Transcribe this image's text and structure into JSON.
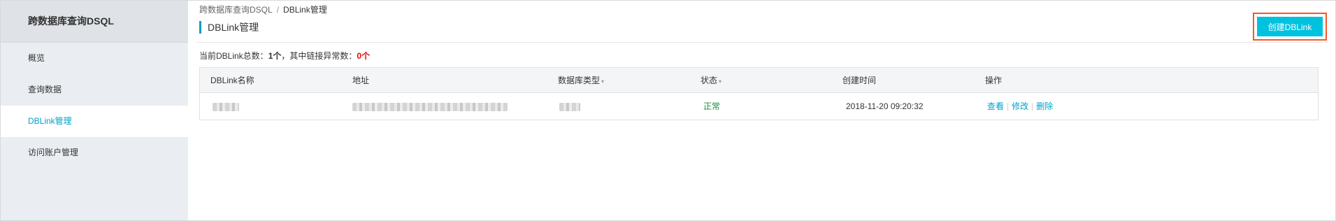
{
  "sidebar": {
    "title": "跨数据库查询DSQL",
    "items": [
      {
        "label": "概览"
      },
      {
        "label": "查询数据"
      },
      {
        "label": "DBLink管理"
      },
      {
        "label": "访问账户管理"
      }
    ]
  },
  "breadcrumb": {
    "parent": "跨数据库查询DSQL",
    "separator": "/",
    "current": "DBLink管理"
  },
  "page": {
    "title": "DBLink管理",
    "create_button": "创建DBLink"
  },
  "summary": {
    "prefix": "当前DBLink总数：",
    "total": "1个",
    "middle": "，其中链接异常数：",
    "abnormal": "0个"
  },
  "table": {
    "headers": {
      "name": "DBLink名称",
      "address": "地址",
      "db_type": "数据库类型",
      "status": "状态",
      "created": "创建时间",
      "actions": "操作"
    },
    "sort_caret": "▾",
    "rows": [
      {
        "status": "正常",
        "created": "2018-11-20 09:20:32",
        "actions": {
          "view": "查看",
          "edit": "修改",
          "delete": "删除",
          "sep": "|"
        }
      }
    ]
  },
  "colors": {
    "accent": "#00c1de",
    "active_nav": "#00a2ca",
    "highlight_border": "#f05a2a",
    "status_ok": "#1e8e3e",
    "error": "#ee0000"
  }
}
